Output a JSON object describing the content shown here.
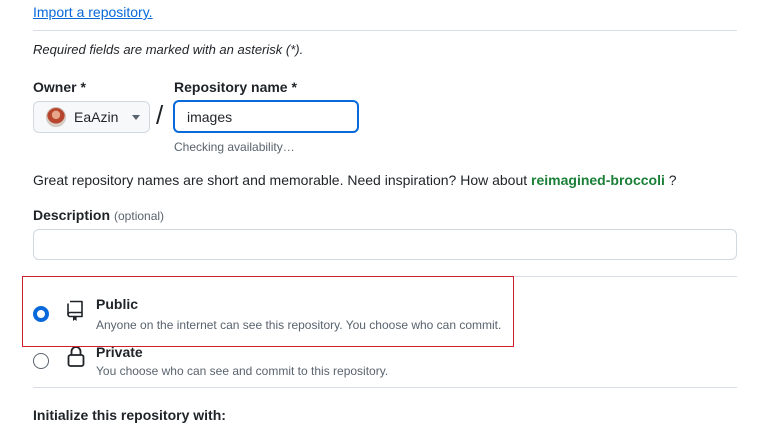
{
  "import_link": "Import a repository.",
  "required_note": "Required fields are marked with an asterisk (*).",
  "owner": {
    "label": "Owner *",
    "selected": "EaAzin"
  },
  "slash": "/",
  "repo": {
    "label": "Repository name *",
    "value": "images",
    "status": "Checking availability…"
  },
  "suggestion": {
    "text": "Great repository names are short and memorable. Need inspiration? How about",
    "name": "reimagined-broccoli",
    "end": "?"
  },
  "description": {
    "label": "Description",
    "optional": "(optional)",
    "value": ""
  },
  "visibility": {
    "public": {
      "title": "Public",
      "desc": "Anyone on the internet can see this repository. You choose who can commit.",
      "icon": "repo-icon",
      "checked": true
    },
    "private": {
      "title": "Private",
      "desc": "You choose who can see and commit to this repository.",
      "icon": "lock-icon",
      "checked": false
    }
  },
  "initialize_label": "Initialize this repository with:",
  "colors": {
    "link": "#0969da",
    "suggestion": "#1a7f37",
    "highlight_box": "#cf222e"
  }
}
